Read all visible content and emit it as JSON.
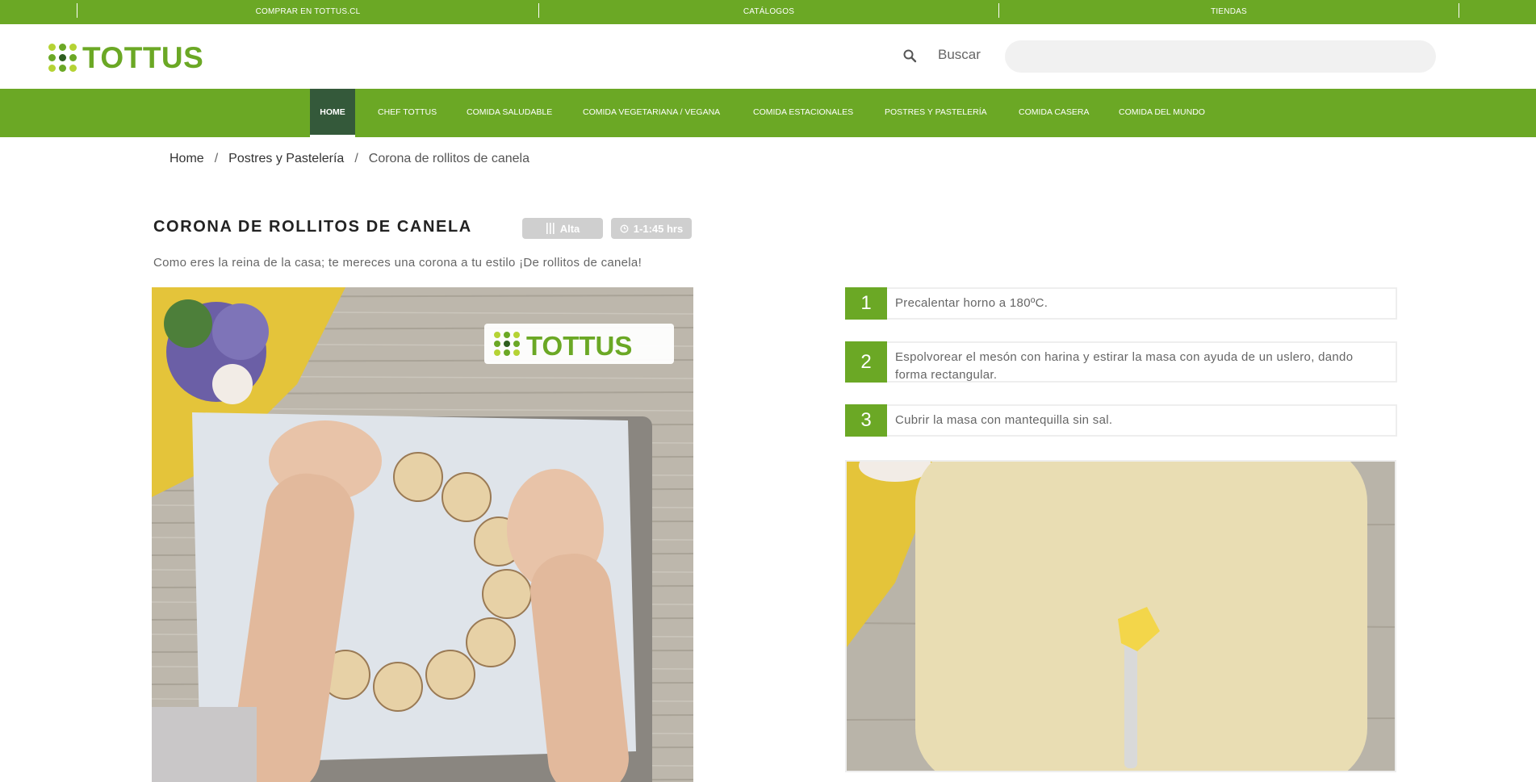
{
  "topbar": {
    "links": [
      "COMPRAR EN TOTTUS.CL",
      "CATÁLOGOS",
      "TIENDAS"
    ]
  },
  "header": {
    "logo_text": "TOTTUS",
    "search_label": "Buscar",
    "search_value": "",
    "search_placeholder": ""
  },
  "nav": {
    "items": [
      "HOME",
      "CHEF TOTTUS",
      "COMIDA SALUDABLE",
      "COMIDA VEGETARIANA / VEGANA",
      "COMIDA ESTACIONALES",
      "POSTRES Y PASTELERÍA",
      "COMIDA CASERA",
      "COMIDA DEL MUNDO"
    ],
    "active": "HOME"
  },
  "breadcrumb": {
    "home": "Home",
    "separator": "/",
    "category": "Postres y Pastelería",
    "current": "Corona de rollitos de canela"
  },
  "recipe": {
    "title": "CORONA DE ROLLITOS DE CANELA",
    "difficulty": "Alta",
    "time": "1-1:45 hrs",
    "description": "Como eres la reina de la casa; te mereces una corona a tu estilo ¡De rollitos de canela!",
    "image_watermark": "TOTTUS"
  },
  "steps": [
    {
      "number": "1",
      "text": "Precalentar horno a 180ºC."
    },
    {
      "number": "2",
      "text": "Espolvorear el mesón con harina y estirar la masa con ayuda de un uslero, dando forma rectangular."
    },
    {
      "number": "3",
      "text": "Cubrir la masa con mantequilla sin sal."
    }
  ],
  "colors": {
    "brand_green": "#6ba825",
    "nav_active": "#34593a",
    "badge_gray": "#cfcfcf",
    "logo_dark_green": "#2e5e1f",
    "logo_light_green": "#b5d334"
  },
  "icons": {
    "search": "search-icon",
    "difficulty": "utensils-icon",
    "time": "clock-icon"
  }
}
